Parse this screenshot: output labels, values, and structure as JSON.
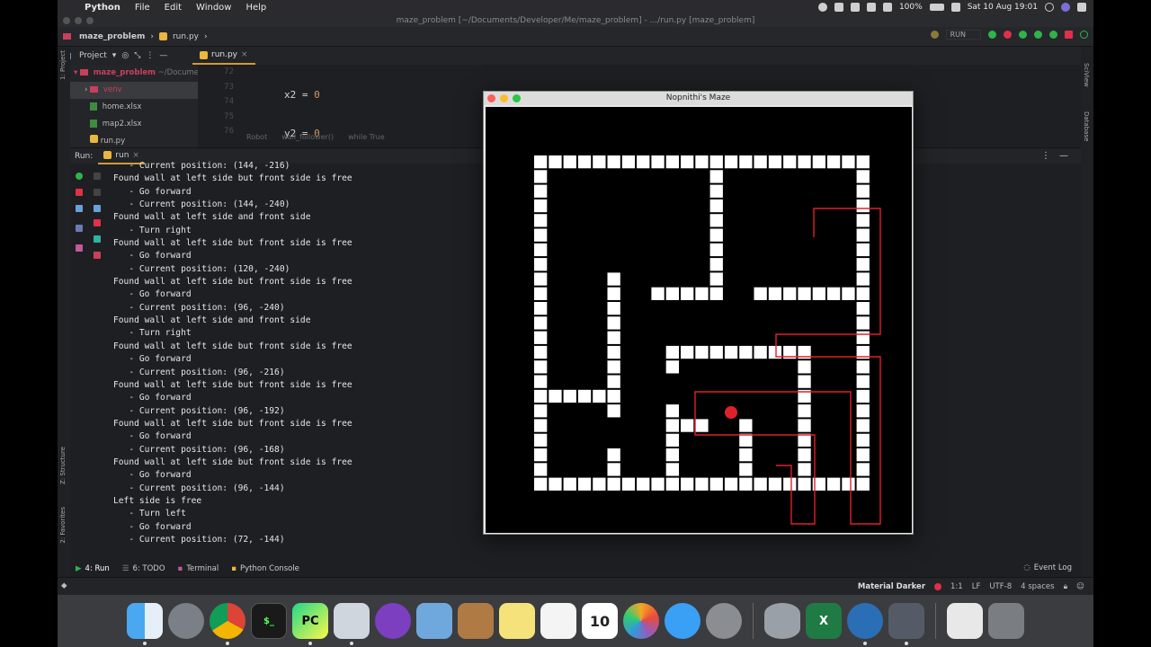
{
  "menubar": {
    "app": "Python",
    "items": [
      "File",
      "Edit",
      "Window",
      "Help"
    ],
    "battery": "100%",
    "clock": "Sat 10 Aug  19:01"
  },
  "window_title": "maze_problem [~/Documents/Developer/Me/maze_problem] - .../run.py [maze_problem]",
  "navbar": {
    "project": "maze_problem",
    "file": "run.py",
    "run_config": "RUN"
  },
  "toolrow": {
    "project_label": "Project",
    "editor_tab": "run.py"
  },
  "side_labels": {
    "project": "1: Project",
    "structure": "Z: Structure",
    "favorites": "2: Favorites",
    "sciview": "SciView",
    "database": "Database"
  },
  "tree": {
    "root": "maze_problem",
    "root_path": "~/Documents",
    "items": [
      "venv",
      "home.xlsx",
      "map2.xlsx",
      "run.py"
    ]
  },
  "editor": {
    "line_numbers": [
      "72",
      "73",
      "74",
      "75",
      "76"
    ],
    "lines": [
      {
        "text": "x2 = 0"
      },
      {
        "text": "y2 = 0"
      },
      {
        "text": "if self.direction == 'north':"
      },
      {
        "text": "x2 = 24"
      },
      {
        "text": "elif self.direction == 'south':"
      }
    ],
    "breadcrumbs": [
      "Robot",
      "wall_follower()",
      "while True"
    ]
  },
  "run_panel": {
    "label": "Run:",
    "tab": "run"
  },
  "console_lines": [
    "   - Current position: (144, -216)",
    "Found wall at left side but front side is free",
    "   - Go forward",
    "   - Current position: (144, -240)",
    "Found wall at left side and front side",
    "   - Turn right",
    "Found wall at left side but front side is free",
    "   - Go forward",
    "   - Current position: (120, -240)",
    "Found wall at left side but front side is free",
    "   - Go forward",
    "   - Current position: (96, -240)",
    "Found wall at left side and front side",
    "   - Turn right",
    "Found wall at left side but front side is free",
    "   - Go forward",
    "   - Current position: (96, -216)",
    "Found wall at left side but front side is free",
    "   - Go forward",
    "   - Current position: (96, -192)",
    "Found wall at left side but front side is free",
    "   - Go forward",
    "   - Current position: (96, -168)",
    "Found wall at left side but front side is free",
    "   - Go forward",
    "   - Current position: (96, -144)",
    "Left side is free",
    "   - Turn left",
    "   - Go forward",
    "   - Current position: (72, -144)"
  ],
  "bottom_tabs": [
    "4: Run",
    "6: TODO",
    "Terminal",
    "Python Console"
  ],
  "event_log": "Event Log",
  "statusbar": {
    "theme": "Material Darker",
    "position": "1:1",
    "line_sep": "LF",
    "encoding": "UTF-8",
    "indent": "4 spaces"
  },
  "maze_window": {
    "title": "Nopnithi's Maze",
    "wall_color": "#ffffff",
    "path_color": "#e0202a",
    "robot_color": "#e0202a",
    "walls_cells": [
      [
        0,
        0,
        0,
        0,
        0,
        0,
        0,
        0,
        0,
        0,
        0,
        0,
        0,
        0,
        0,
        0,
        0,
        0,
        0,
        0,
        0,
        0,
        0,
        0,
        0
      ],
      [
        1,
        1,
        1,
        1,
        1,
        1,
        1,
        1,
        1,
        1,
        1,
        1,
        1,
        1,
        1,
        1,
        1,
        1,
        1,
        1,
        1,
        1,
        1,
        1,
        1
      ],
      [
        1,
        0,
        0,
        0,
        0,
        0,
        0,
        0,
        0,
        0,
        0,
        0,
        1,
        0,
        0,
        0,
        0,
        0,
        0,
        0,
        0,
        0,
        0,
        0,
        1
      ],
      [
        1,
        0,
        0,
        0,
        0,
        0,
        0,
        0,
        0,
        0,
        0,
        0,
        1,
        0,
        0,
        0,
        0,
        0,
        0,
        0,
        0,
        0,
        0,
        0,
        1
      ],
      [
        1,
        0,
        0,
        0,
        0,
        0,
        0,
        0,
        0,
        0,
        0,
        0,
        1,
        0,
        0,
        0,
        0,
        0,
        0,
        0,
        0,
        0,
        0,
        0,
        1
      ],
      [
        1,
        0,
        0,
        0,
        0,
        0,
        0,
        0,
        0,
        0,
        0,
        0,
        1,
        0,
        0,
        0,
        0,
        0,
        0,
        0,
        0,
        0,
        0,
        0,
        1
      ],
      [
        1,
        0,
        0,
        0,
        0,
        0,
        0,
        0,
        0,
        0,
        0,
        0,
        1,
        0,
        0,
        0,
        0,
        0,
        0,
        0,
        0,
        0,
        0,
        0,
        1
      ],
      [
        1,
        0,
        0,
        0,
        0,
        0,
        0,
        0,
        0,
        0,
        0,
        0,
        1,
        0,
        0,
        0,
        0,
        0,
        0,
        0,
        0,
        0,
        0,
        0,
        1
      ],
      [
        1,
        0,
        0,
        0,
        0,
        0,
        0,
        0,
        0,
        0,
        0,
        0,
        1,
        0,
        0,
        0,
        0,
        0,
        0,
        0,
        0,
        0,
        0,
        0,
        1
      ],
      [
        1,
        0,
        0,
        0,
        0,
        0,
        0,
        0,
        0,
        0,
        0,
        0,
        1,
        0,
        0,
        0,
        0,
        0,
        0,
        0,
        0,
        0,
        0,
        0,
        1
      ],
      [
        1,
        0,
        0,
        0,
        0,
        0,
        0,
        0,
        0,
        0,
        0,
        0,
        1,
        0,
        0,
        0,
        0,
        0,
        0,
        0,
        0,
        0,
        0,
        0,
        1
      ]
    ]
  }
}
